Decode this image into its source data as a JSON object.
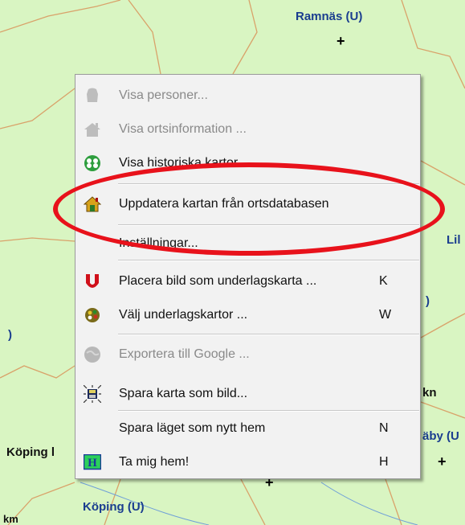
{
  "map": {
    "labels": {
      "ramnas": "Ramnäs (U)",
      "koping_left": "Köping l",
      "koping_bottom": "Köping (U)",
      "km": "km",
      "lil": "Lil",
      "u_right": ")",
      "u_left": ")",
      "kn": "kn",
      "aby": "äby (U"
    }
  },
  "context_menu": {
    "items": {
      "visa_personer": {
        "label": "Visa personer...",
        "enabled": false,
        "icon": "person-silhouette-icon"
      },
      "visa_ortsinformation": {
        "label": "Visa ortsinformation ...",
        "enabled": false,
        "icon": "house-icon"
      },
      "visa_historiska_kartor": {
        "label": "Visa historiska kartor ...",
        "enabled": true,
        "icon": "historic-map-icon"
      },
      "uppdatera_kartan": {
        "label": "Uppdatera kartan från ortsdatabasen",
        "enabled": true,
        "icon": "update-house-icon"
      },
      "installningar": {
        "label": "Inställningar...",
        "enabled": true,
        "icon": ""
      },
      "placera_bild": {
        "label": "Placera bild som underlagskarta ...",
        "shortcut": "K",
        "enabled": true,
        "icon": "u-magnet-icon"
      },
      "valj_underlagskartor": {
        "label": "Välj underlagskartor ...",
        "shortcut": "W",
        "enabled": true,
        "icon": "palette-icon"
      },
      "exportera_google": {
        "label": "Exportera till Google ...",
        "enabled": false,
        "icon": "globe-icon"
      },
      "spara_karta": {
        "label": "Spara karta som bild...",
        "enabled": true,
        "icon": "save-image-icon"
      },
      "spara_laget": {
        "label": "Spara läget som nytt hem",
        "shortcut": "N",
        "enabled": true,
        "icon": ""
      },
      "ta_mig_hem": {
        "label": "Ta mig hem!",
        "shortcut": "H",
        "enabled": true,
        "icon": "home-h-icon"
      }
    }
  },
  "colors": {
    "map_background": "#d9f5c2",
    "highlight_ring": "#e8121b",
    "menu_background": "#f2f2f2"
  }
}
